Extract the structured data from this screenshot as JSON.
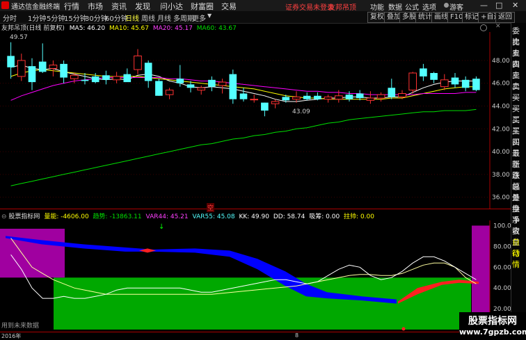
{
  "window": {
    "logo_text": "通达信金融终端",
    "menus": [
      "行情",
      "市场",
      "资讯",
      "发现",
      "问小达",
      "财富圈",
      "交易"
    ],
    "notice": "证券交易未登录",
    "broker": "友邦吊顶",
    "right_menus": [
      "功能",
      "数据",
      "公式",
      "选项"
    ],
    "guest": "游客",
    "win_controls": [
      "—",
      "□",
      "✕"
    ]
  },
  "toolbar": {
    "periods": [
      "分时",
      "1分钟",
      "5分钟",
      "15分钟",
      "30分钟",
      "60分钟",
      "日线",
      "周线",
      "月线",
      "多周期",
      "更多"
    ],
    "active_period": "日线",
    "buttons": [
      "复权",
      "叠加",
      "多股",
      "统计",
      "画线",
      "F10",
      "标记",
      "+自选",
      "返回"
    ]
  },
  "main_info": {
    "stock": "友邦吊顶(日线 前复权)",
    "ma5": "MA5: 46.20",
    "ma10": "MA10: 45.67",
    "ma20": "MA20: 45.17",
    "ma60": "MA60: 43.67"
  },
  "sub_info": {
    "name": "股票指标网",
    "lv": "量能: -4606.00",
    "qs": "趋势: -13863.11",
    "var44": "VAR44: 45.21",
    "var55": "VAR55: 45.08",
    "kk": "KK: 49.90",
    "dd": "DD: 58.74",
    "xc": "吸筹: 0.00",
    "zs": "拄帅: 0.00"
  },
  "labels": {
    "high": "49.57",
    "low": "43.09",
    "kong": "空",
    "no_data": "用到未来数据",
    "year": "2016年",
    "date_mark": "8"
  },
  "side_panel": {
    "items": [
      "委比",
      "卖五",
      "卖四",
      "卖三",
      "卖二",
      "卖一",
      "买一",
      "买二",
      "买三",
      "买四",
      "买五",
      "最新",
      "涨跌",
      "涨幅",
      "总量",
      "外盘",
      "换手",
      "净资",
      "收益",
      "自动",
      "行情"
    ]
  },
  "watermark": {
    "text1": "股票指标网",
    "text2": "www.7gpzb.com"
  },
  "colors": {
    "up": "#ff3232",
    "down": "#54ffff",
    "ma5": "#ffffff",
    "ma10": "#ffff00",
    "ma20": "#ff00ff",
    "ma60": "#00e000",
    "green_zone": "#00a800",
    "purple_zone": "#a000a0",
    "blue_band": "#0000ff",
    "red_band": "#ff2020"
  },
  "chart_data": [
    {
      "type": "candlestick",
      "title": "友邦吊顶(日线 前复权)",
      "y_ticks": [
        48.0,
        46.0,
        44.0,
        42.0,
        40.0,
        38.0,
        36.0
      ],
      "ylim": [
        35.0,
        50.5
      ],
      "candles": [
        {
          "o": 48.4,
          "h": 49.6,
          "l": 46.4,
          "c": 47.4
        },
        {
          "o": 46.6,
          "h": 48.6,
          "l": 46.2,
          "c": 48.0
        },
        {
          "o": 47.5,
          "h": 48.2,
          "l": 45.4,
          "c": 46.1
        },
        {
          "o": 47.9,
          "h": 49.5,
          "l": 46.9,
          "c": 47.0
        },
        {
          "o": 47.3,
          "h": 48.0,
          "l": 46.6,
          "c": 47.6
        },
        {
          "o": 47.7,
          "h": 48.0,
          "l": 46.0,
          "c": 46.5
        },
        {
          "o": 46.4,
          "h": 46.9,
          "l": 46.0,
          "c": 46.7
        },
        {
          "o": 46.3,
          "h": 46.9,
          "l": 45.9,
          "c": 46.2
        },
        {
          "o": 46.6,
          "h": 46.9,
          "l": 46.0,
          "c": 46.1
        },
        {
          "o": 46.7,
          "h": 47.1,
          "l": 45.9,
          "c": 46.3
        },
        {
          "o": 46.3,
          "h": 47.0,
          "l": 46.0,
          "c": 46.6
        },
        {
          "o": 46.8,
          "h": 47.3,
          "l": 46.2,
          "c": 46.1
        },
        {
          "o": 47.2,
          "h": 49.0,
          "l": 46.8,
          "c": 48.4
        },
        {
          "o": 47.8,
          "h": 48.0,
          "l": 45.6,
          "c": 46.2
        },
        {
          "o": 46.2,
          "h": 46.4,
          "l": 44.9,
          "c": 44.9
        },
        {
          "o": 45.0,
          "h": 45.6,
          "l": 44.6,
          "c": 45.4
        },
        {
          "o": 46.4,
          "h": 47.6,
          "l": 45.7,
          "c": 46.0
        },
        {
          "o": 45.9,
          "h": 46.2,
          "l": 45.2,
          "c": 45.6
        },
        {
          "o": 45.4,
          "h": 45.8,
          "l": 45.0,
          "c": 45.6
        },
        {
          "o": 46.3,
          "h": 46.6,
          "l": 45.3,
          "c": 45.7
        },
        {
          "o": 45.8,
          "h": 46.4,
          "l": 45.1,
          "c": 46.1
        },
        {
          "o": 46.8,
          "h": 47.2,
          "l": 44.2,
          "c": 44.6
        },
        {
          "o": 45.1,
          "h": 45.6,
          "l": 44.4,
          "c": 44.6
        },
        {
          "o": 44.6,
          "h": 45.0,
          "l": 44.3,
          "c": 44.6
        },
        {
          "o": 44.3,
          "h": 44.3,
          "l": 43.1,
          "c": 43.6
        },
        {
          "o": 44.2,
          "h": 44.6,
          "l": 43.8,
          "c": 44.4
        },
        {
          "o": 44.8,
          "h": 45.0,
          "l": 44.3,
          "c": 44.5
        },
        {
          "o": 44.6,
          "h": 45.3,
          "l": 44.3,
          "c": 44.8
        },
        {
          "o": 44.9,
          "h": 45.2,
          "l": 44.5,
          "c": 44.6
        },
        {
          "o": 44.9,
          "h": 45.2,
          "l": 44.5,
          "c": 44.6
        },
        {
          "o": 44.6,
          "h": 45.0,
          "l": 44.3,
          "c": 44.8
        },
        {
          "o": 44.6,
          "h": 45.4,
          "l": 44.3,
          "c": 44.9
        },
        {
          "o": 45.0,
          "h": 45.3,
          "l": 44.4,
          "c": 44.6
        },
        {
          "o": 45.1,
          "h": 45.4,
          "l": 44.5,
          "c": 44.7
        },
        {
          "o": 44.5,
          "h": 45.3,
          "l": 44.2,
          "c": 44.7
        },
        {
          "o": 44.7,
          "h": 45.2,
          "l": 44.4,
          "c": 45.0
        },
        {
          "o": 45.6,
          "h": 46.4,
          "l": 44.6,
          "c": 44.8
        },
        {
          "o": 44.8,
          "h": 45.4,
          "l": 44.6,
          "c": 45.1
        },
        {
          "o": 45.4,
          "h": 47.0,
          "l": 45.1,
          "c": 46.9
        },
        {
          "o": 47.3,
          "h": 47.7,
          "l": 46.2,
          "c": 46.6
        },
        {
          "o": 46.9,
          "h": 47.0,
          "l": 46.0,
          "c": 46.3
        },
        {
          "o": 45.7,
          "h": 46.8,
          "l": 45.4,
          "c": 46.3
        },
        {
          "o": 46.5,
          "h": 46.9,
          "l": 45.6,
          "c": 45.9
        },
        {
          "o": 46.3,
          "h": 46.6,
          "l": 45.3,
          "c": 45.6
        },
        {
          "o": 46.4,
          "h": 46.6,
          "l": 45.3,
          "c": 45.4
        }
      ],
      "series": [
        {
          "name": "MA5",
          "values": [
            47.4,
            47.6,
            47.3,
            47.2,
            47.3,
            47.0,
            46.8,
            46.6,
            46.4,
            46.3,
            46.4,
            46.3,
            46.7,
            46.8,
            46.6,
            46.2,
            46.0,
            45.7,
            45.6,
            45.7,
            45.6,
            45.5,
            45.3,
            45.1,
            44.9,
            44.6,
            44.4,
            44.4,
            44.5,
            44.6,
            44.7,
            44.7,
            44.8,
            44.8,
            44.7,
            44.7,
            44.8,
            44.8,
            45.2,
            45.6,
            45.9,
            46.1,
            46.2,
            46.2,
            46.2
          ]
        },
        {
          "name": "MA10",
          "values": [
            46.6,
            46.9,
            47.1,
            47.2,
            47.1,
            47.0,
            46.9,
            46.8,
            46.7,
            46.6,
            46.6,
            46.6,
            46.6,
            46.5,
            46.4,
            46.3,
            46.2,
            46.1,
            46.0,
            45.9,
            45.8,
            45.7,
            45.6,
            45.5,
            45.3,
            45.1,
            44.9,
            44.8,
            44.7,
            44.7,
            44.6,
            44.6,
            44.6,
            44.6,
            44.6,
            44.6,
            44.7,
            44.7,
            44.9,
            45.1,
            45.3,
            45.5,
            45.6,
            45.7,
            45.7
          ]
        },
        {
          "name": "MA20",
          "values": [
            44.5,
            44.9,
            45.2,
            45.5,
            45.8,
            46.0,
            46.2,
            46.3,
            46.4,
            46.5,
            46.5,
            46.5,
            46.5,
            46.5,
            46.5,
            46.4,
            46.4,
            46.3,
            46.2,
            46.2,
            46.1,
            46.0,
            45.9,
            45.8,
            45.7,
            45.6,
            45.5,
            45.4,
            45.3,
            45.3,
            45.2,
            45.2,
            45.1,
            45.1,
            45.0,
            45.0,
            45.0,
            45.0,
            45.0,
            45.1,
            45.1,
            45.1,
            45.1,
            45.2,
            45.2
          ]
        },
        {
          "name": "MA60",
          "values": [
            37.0,
            37.2,
            37.4,
            37.6,
            37.8,
            38.0,
            38.2,
            38.4,
            38.6,
            38.8,
            39.0,
            39.2,
            39.4,
            39.6,
            39.8,
            40.0,
            40.2,
            40.4,
            40.6,
            40.7,
            40.9,
            41.1,
            41.2,
            41.4,
            41.5,
            41.7,
            41.8,
            42.0,
            42.1,
            42.3,
            42.5,
            42.6,
            42.8,
            42.9,
            43.0,
            43.1,
            43.2,
            43.3,
            43.4,
            43.5,
            43.5,
            43.6,
            43.6,
            43.6,
            43.7
          ]
        }
      ]
    },
    {
      "type": "line",
      "title": "股票指标网",
      "y_ticks": [
        100.0,
        80.0,
        60.0,
        40.0,
        20.0
      ],
      "ylim": [
        0,
        105
      ],
      "series": [
        {
          "name": "VAR44",
          "values": [
            88,
            74,
            60,
            54,
            48,
            44,
            40,
            38,
            36,
            34,
            34,
            34,
            34,
            34,
            34,
            34,
            34,
            34,
            34,
            34,
            35,
            36,
            37,
            38,
            39,
            40,
            41,
            42,
            44,
            46,
            48,
            50,
            52,
            53,
            53,
            52,
            52,
            54,
            58,
            62,
            64,
            64,
            60,
            50,
            44
          ]
        },
        {
          "name": "VAR55",
          "values": [
            72,
            58,
            40,
            30,
            30,
            32,
            30,
            30,
            32,
            34,
            38,
            40,
            40,
            40,
            40,
            40,
            40,
            38,
            36,
            36,
            38,
            40,
            42,
            44,
            46,
            48,
            48,
            46,
            44,
            46,
            52,
            58,
            62,
            60,
            52,
            48,
            50,
            56,
            64,
            70,
            70,
            66,
            60,
            54,
            48
          ]
        }
      ]
    }
  ]
}
